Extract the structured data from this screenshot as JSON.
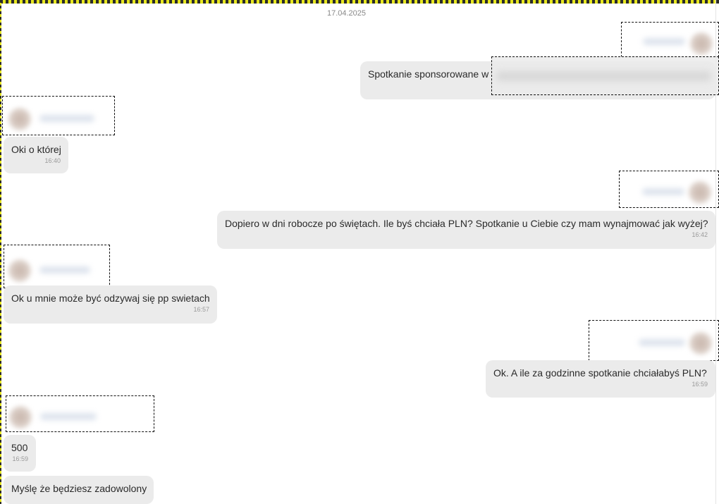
{
  "date_separator": "17.04.2025",
  "messages": [
    {
      "direction": "out",
      "text": "Spotkanie sponsorowane w",
      "time": ""
    },
    {
      "direction": "in",
      "text": "Oki o której",
      "time": "16:40"
    },
    {
      "direction": "out",
      "text": "Dopiero w dni robocze po świętach. Ile byś chciała PLN? Spotkanie u Ciebie czy mam wynajmować jak wyżej?",
      "time": "16:42"
    },
    {
      "direction": "in",
      "text": "Ok u mnie może być odzywaj się pp swietach",
      "time": "16:57"
    },
    {
      "direction": "out",
      "text": "Ok. A ile za godzinne spotkanie chciałabyś PLN?",
      "time": "16:59"
    },
    {
      "direction": "in",
      "text": "500",
      "time": "16:59"
    },
    {
      "direction": "in",
      "text": "Myślę że będziesz zadowolony",
      "time": ""
    }
  ]
}
